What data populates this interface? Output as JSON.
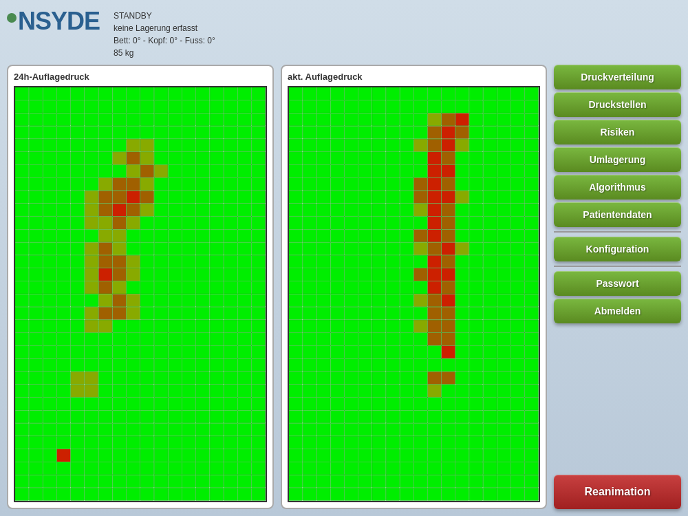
{
  "header": {
    "logo": "INSYDE",
    "status_line1": "STANDBY",
    "status_line2": "keine Lagerung erfasst",
    "status_line3": "Bett: 0° - Kopf: 0° - Fuss: 0°",
    "status_line4": "85 kg"
  },
  "panels": {
    "panel1_title": "24h-Auflagedruck",
    "panel2_title": "akt. Auflagedruck"
  },
  "buttons": {
    "druckverteilung": "Druckverteilung",
    "druckstellen": "Druckstellen",
    "risiken": "Risiken",
    "umlagerung": "Umlagerung",
    "algorithmus": "Algorithmus",
    "patientendaten": "Patientendaten",
    "konfiguration": "Konfiguration",
    "passwort": "Passwort",
    "abmelden": "Abmelden",
    "reanimation": "Reanimation"
  },
  "colors": {
    "green": "#00ff00",
    "olive": "#808000",
    "dark_olive": "#6b6b00",
    "red": "#cc0000",
    "button_green": "#7ab840",
    "button_red": "#c84040"
  }
}
